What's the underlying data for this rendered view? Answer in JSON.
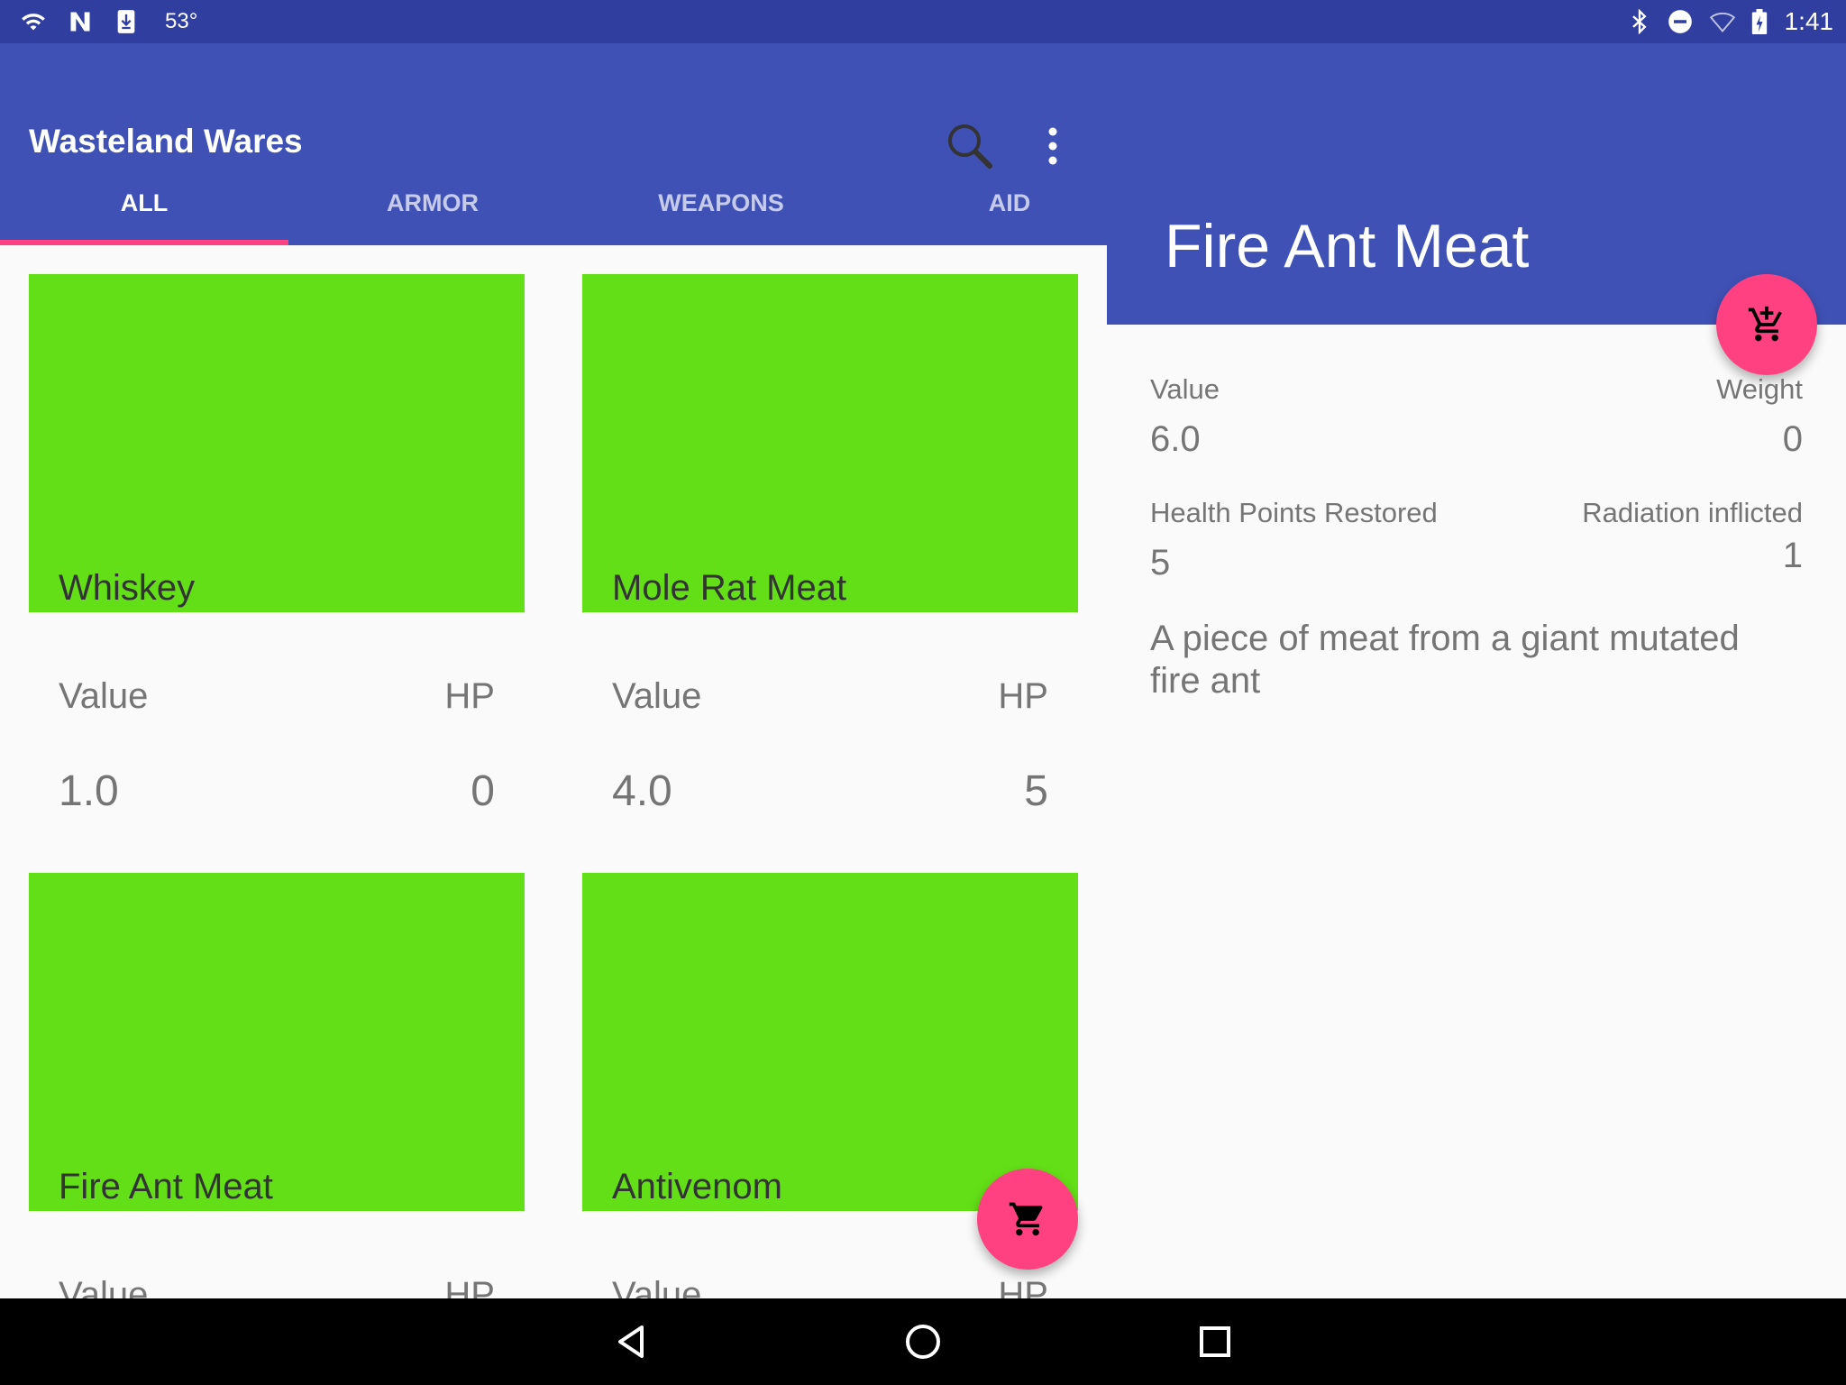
{
  "status_bar": {
    "temperature": "53°",
    "time": "1:41",
    "icons_left": [
      "wifi-icon",
      "n-icon",
      "download-icon"
    ],
    "icons_right": [
      "bluetooth-icon",
      "do-not-disturb-icon",
      "wifi-outline-icon",
      "battery-charging-icon"
    ]
  },
  "app": {
    "title": "Wasteland Wares",
    "actions": [
      "search-icon",
      "more-vert-icon"
    ]
  },
  "tabs": [
    {
      "label": "ALL",
      "active": true
    },
    {
      "label": "ARMOR",
      "active": false
    },
    {
      "label": "WEAPONS",
      "active": false
    },
    {
      "label": "AID",
      "active": false
    }
  ],
  "items": [
    {
      "name": "Whiskey",
      "label1": "Value",
      "label2": "HP",
      "value1": "1.0",
      "value2": "0"
    },
    {
      "name": "Mole Rat Meat",
      "label1": "Value",
      "label2": "HP",
      "value1": "4.0",
      "value2": "5"
    },
    {
      "name": "Fire Ant Meat",
      "label1": "Value",
      "label2": "HP",
      "value1": "",
      "value2": ""
    },
    {
      "name": "Antivenom",
      "label1": "Value",
      "label2": "HP",
      "value1": "",
      "value2": ""
    }
  ],
  "detail": {
    "title": "Fire Ant Meat",
    "value_label": "Value",
    "value": "6.0",
    "weight_label": "Weight",
    "weight": "0",
    "hp_label": "Health Points Restored",
    "hp": "5",
    "rad_label": "Radiation inflicted",
    "rad": "1",
    "description": "A piece of meat from a giant mutated fire ant"
  },
  "colors": {
    "primary": "#3f51b5",
    "primary_dark": "#303f9f",
    "accent": "#ff4081",
    "card_image": "#63df17"
  },
  "navbar": [
    "back-icon",
    "home-icon",
    "recents-icon"
  ]
}
